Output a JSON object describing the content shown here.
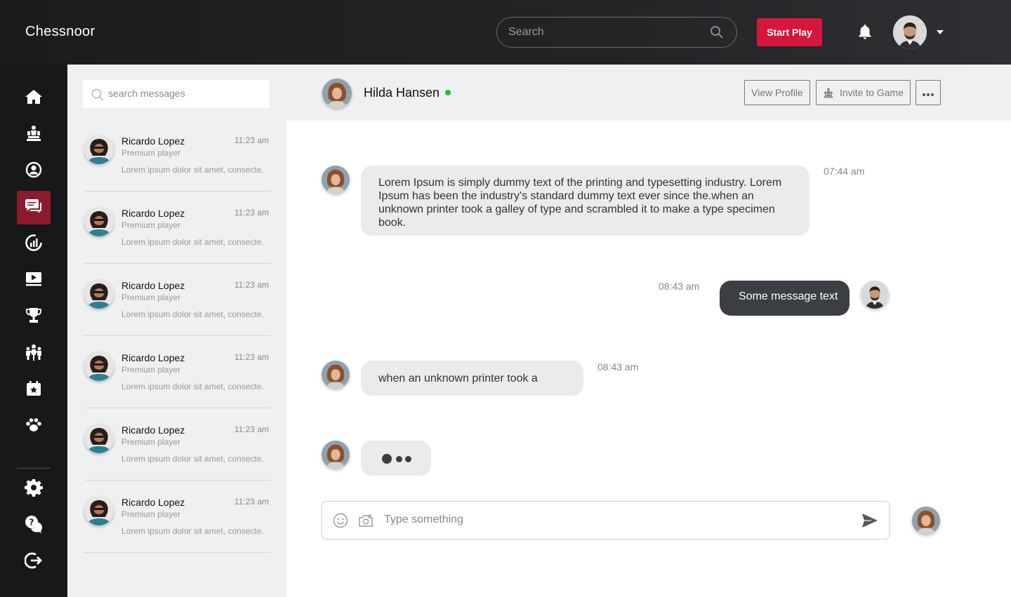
{
  "app": {
    "title": "Chessnoor"
  },
  "topbar": {
    "search_placeholder": "Search",
    "start_play_label": "Start Play"
  },
  "sidebar": {
    "items": [
      {
        "icon": "home-icon",
        "active": false
      },
      {
        "icon": "chess-pieces-icon",
        "active": false
      },
      {
        "icon": "user-circle-icon",
        "active": false
      },
      {
        "icon": "chat-icon",
        "active": true
      },
      {
        "icon": "stats-icon",
        "active": false
      },
      {
        "icon": "video-icon",
        "active": false
      },
      {
        "icon": "trophy-icon",
        "active": false
      },
      {
        "icon": "community-icon",
        "active": false
      },
      {
        "icon": "calendar-star-icon",
        "active": false
      },
      {
        "icon": "paw-icon",
        "active": false
      }
    ],
    "bottom_items": [
      {
        "icon": "gear-icon"
      },
      {
        "icon": "help-chat-icon"
      },
      {
        "icon": "logout-icon"
      }
    ]
  },
  "messages_panel": {
    "search_placeholder": "search messages",
    "conversations": [
      {
        "name": "Ricardo Lopez",
        "role": "Premium player",
        "time": "11:23 am",
        "preview": "Lorem ipsum dolor sit amet, consecte."
      },
      {
        "name": "Ricardo Lopez",
        "role": "Premium player",
        "time": "11:23 am",
        "preview": "Lorem ipsum dolor sit amet, consecte."
      },
      {
        "name": "Ricardo Lopez",
        "role": "Premium player",
        "time": "11:23 am",
        "preview": "Lorem ipsum dolor sit amet, consecte."
      },
      {
        "name": "Ricardo Lopez",
        "role": "Premium player",
        "time": "11:23 am",
        "preview": "Lorem ipsum dolor sit amet, consecte."
      },
      {
        "name": "Ricardo Lopez",
        "role": "Premium player",
        "time": "11:23 am",
        "preview": "Lorem ipsum dolor sit amet, consecte."
      },
      {
        "name": "Ricardo Lopez",
        "role": "Premium player",
        "time": "11:23 am",
        "preview": "Lorem ipsum dolor sit amet, consecte."
      }
    ]
  },
  "chat": {
    "contact_name": "Hilda Hansen",
    "status": "online",
    "view_profile_label": "View Profile",
    "invite_label": "Invite to Game",
    "messages": [
      {
        "from": "contact",
        "text": "Lorem Ipsum is simply dummy text of the printing and typesetting industry. Lorem Ipsum has been the industry's standard dummy text ever since the.when an unknown printer took a galley of type and scrambled it to make a type specimen book.",
        "time": "07:44 am"
      },
      {
        "from": "me",
        "text": "Some message text",
        "time": "08:43 am"
      },
      {
        "from": "contact",
        "text": "when an unknown printer took a",
        "time": "08:43 am"
      }
    ],
    "composer_placeholder": "Type something"
  },
  "colors": {
    "accent": "#d4173b",
    "active_nav": "#8b1a2a",
    "online": "#1bbf3a"
  }
}
